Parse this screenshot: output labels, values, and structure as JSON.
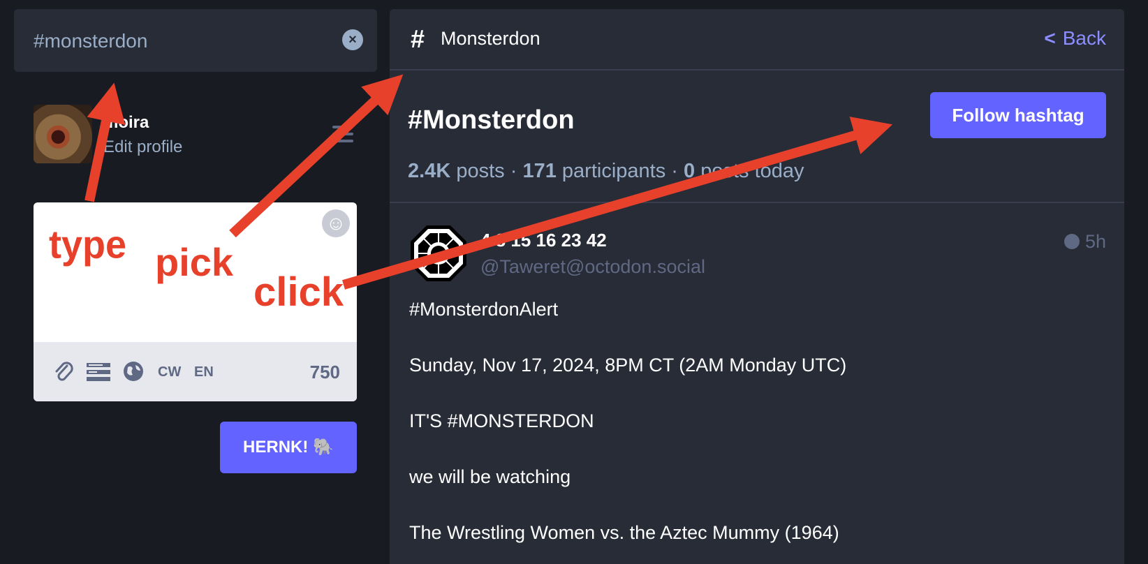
{
  "search": {
    "value": "#monsterdon",
    "clear_icon": "clear-circle-icon"
  },
  "profile": {
    "name": "moira",
    "edit_label": "Edit profile"
  },
  "compose": {
    "footer": {
      "cw_label": "CW",
      "lang_label": "EN",
      "char_count": "750"
    },
    "post_button": "HERNK! 🐘"
  },
  "column": {
    "header_icon": "#",
    "title": "Monsterdon",
    "back_label": "Back"
  },
  "hashtag": {
    "title": "#Monsterdon",
    "follow_label": "Follow hashtag",
    "stats": {
      "posts_count": "2.4K",
      "posts_label": "posts",
      "participants_count": "171",
      "participants_label": "participants",
      "today_count": "0",
      "today_label": "posts today",
      "separator": "·"
    }
  },
  "status": {
    "display_name": "4 8 15 16 23 42",
    "handle": "@Taweret@octodon.social",
    "time": "5h",
    "lines": [
      "#MonsterdonAlert",
      "Sunday, Nov 17,  2024, 8PM CT (2AM Monday UTC)",
      "IT'S #MONSTERDON",
      "we will be watching",
      "The Wrestling Women vs. the Aztec Mummy (1964)"
    ]
  },
  "annotations": {
    "word1": "type",
    "word2": "pick",
    "word3": "click"
  },
  "colors": {
    "accent": "#6364ff",
    "annotation": "#e8412b",
    "link": "#8c8dff"
  }
}
